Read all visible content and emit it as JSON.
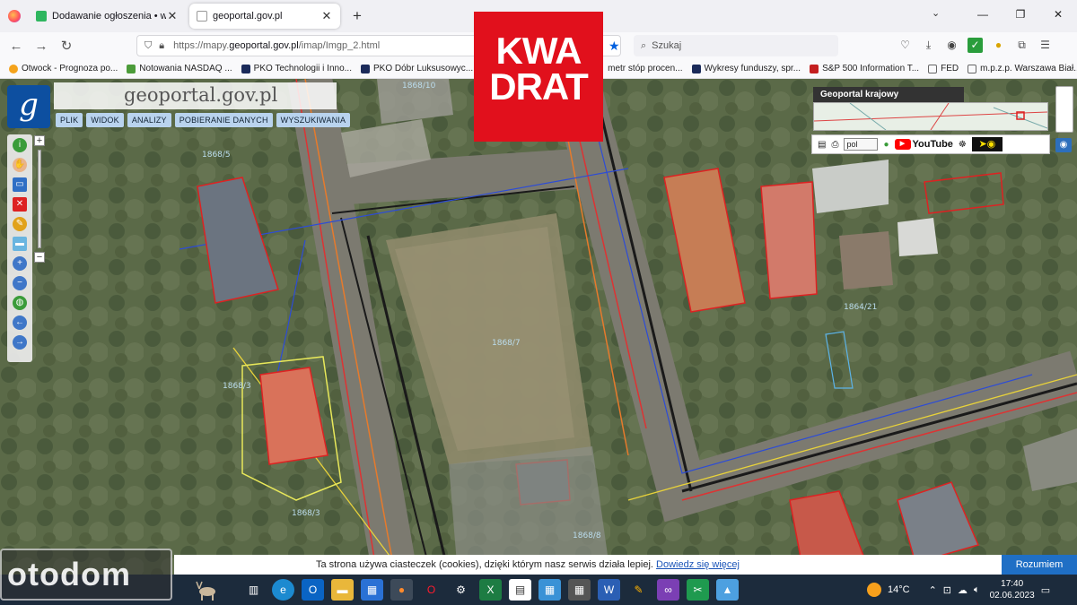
{
  "browser": {
    "tabs": [
      {
        "label": "Dodawanie ogłoszenia • www.o",
        "active": false
      },
      {
        "label": "geoportal.gov.pl",
        "active": true
      }
    ],
    "url_prefix": "https://mapy.",
    "url_host": "geoportal.gov.pl",
    "url_path": "/imap/Imgp_2.html",
    "search_placeholder": "Szukaj",
    "bookmarks": [
      {
        "label": "Otwock - Prognoza po...",
        "icon_color": "#f4a31c"
      },
      {
        "label": "Notowania NASDAQ ...",
        "icon_color": "#4c9c3a"
      },
      {
        "label": "PKO Technologii i Inno...",
        "icon_color": "#1b2b5a"
      },
      {
        "label": "PKO Dóbr Luksusowyc...",
        "icon_color": "#1b2b5a"
      },
      {
        "label": "metr stóp procen...",
        "icon_color": "#1b2b5a"
      },
      {
        "label": "Wykresy funduszy, spr...",
        "icon_color": "#1b2b5a"
      },
      {
        "label": "S&P 500 Information T...",
        "icon_color": "#c41f1f"
      },
      {
        "label": "FED",
        "icon_color": "#888888"
      },
      {
        "label": "m.p.z.p. Warszawa Biał...",
        "icon_color": "#888888"
      }
    ]
  },
  "geoportal": {
    "site_title": "geoportal.gov.pl",
    "menu": [
      "PLIK",
      "WIDOK",
      "ANALIZY",
      "POBIERANIE DANYCH",
      "WYSZUKIWANIA"
    ],
    "minimap_title": "Geoportal krajowy",
    "language": "pol",
    "youtube": "YouTube",
    "parcel_labels": [
      "1868/10",
      "1868/5",
      "1868/7",
      "1868/3",
      "1868/8",
      "1864/21",
      "1868/3"
    ]
  },
  "watermark": {
    "line1": "KWA",
    "line2": "DRAT"
  },
  "cookie": {
    "text": "Ta strona używa ciasteczek (cookies), dzięki którym nasz serwis działa lepiej.",
    "link": "Dowiedz się więcej",
    "accept": "Rozumiem"
  },
  "otodom_watermark": "otodom",
  "taskbar": {
    "temperature": "14°C",
    "time": "17:40",
    "date": "02.06.2023"
  }
}
